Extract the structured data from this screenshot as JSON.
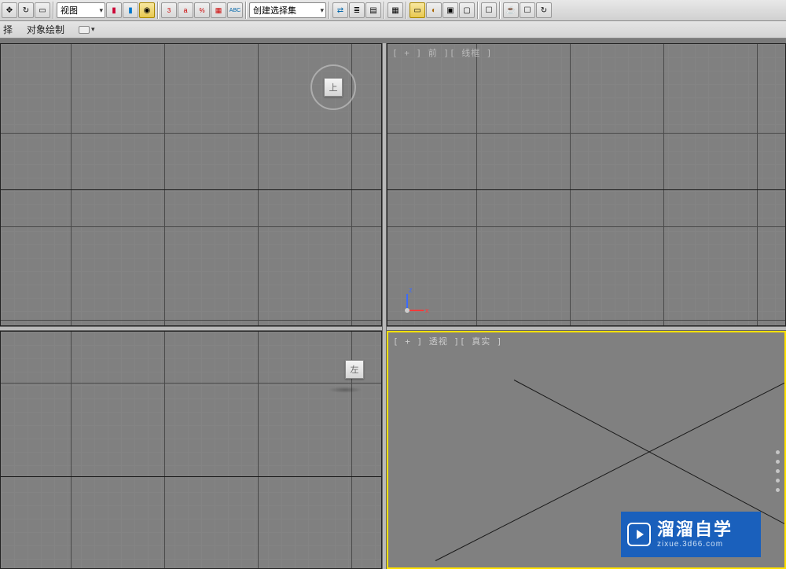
{
  "toolbar": {
    "view_mode": "视图",
    "selection_set": "创建选择集"
  },
  "subbar": {
    "item1": "择",
    "item2": "对象绘制"
  },
  "viewports": {
    "top_left": {
      "label": "",
      "cube_face": "上"
    },
    "top_right": {
      "label": "[ + ] 前 ][ 线框 ]"
    },
    "bottom_left": {
      "label": "",
      "cube_face": "左"
    },
    "bottom_right": {
      "label": "[ + ] 透视 ][ 真实 ]"
    }
  },
  "watermark": {
    "title": "溜溜自学",
    "sub": "zixue.3d66.com"
  }
}
